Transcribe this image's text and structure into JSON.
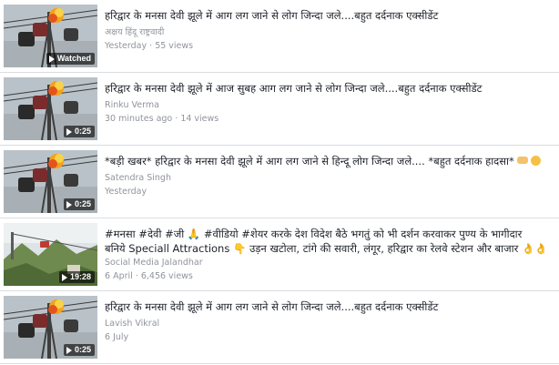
{
  "icons": {
    "play": "play-icon"
  },
  "videos": [
    {
      "title": "हरिद्वार के मनसा देवी झूले में आग लग जाने से लोग जिन्दा जले....बहुत दर्दनाक एक्सीडेंट",
      "channel": "अक्षय हिंदू राष्ट्रवादी",
      "date": "Yesterday",
      "views": "55 views",
      "badge": "Watched"
    },
    {
      "title": "हरिद्वार के मनसा देवी झूले में आज सुबह आग लग जाने से लोग जिन्दा जले....बहुत दर्दनाक एक्सीडेंट",
      "channel": "Rinku Verma",
      "date": "30 minutes ago",
      "views": "14 views",
      "badge": "0:25"
    },
    {
      "title": "*बड़ी खबर* हरिद्वार के मनसा देवी झूले में आग लग जाने से हिन्दू लोग जिन्दा जले.... *बहुत दर्दनाक हादसा*",
      "channel": "Satendra Singh",
      "date": "Yesterday",
      "views": "",
      "badge": "0:25"
    },
    {
      "title_line1": "#मनसा #देवी #जी 🙏 #वीडियो #शेयर करके देश विदेश बैठे भगतुं को भी दर्शन करवाकर पुण्य के भागीदार",
      "title_line2": "बनिये Speciall Attractions 👇 उड़न खटोला, टांगे की सवारी, लंगूर, हरिद्वार का रेलवे स्टेशन और बाजार 👌👌",
      "channel": "Social Media Jalandhar",
      "date": "6 April",
      "views": "6,456 views",
      "badge": "19:28"
    },
    {
      "title": "हरिद्वार के मनसा देवी झूले में आग लग जाने से लोग जिन्दा जले....बहुत दर्दनाक एक्सीडेंट",
      "channel": "Lavish Vikral",
      "date": "6 July",
      "views": "",
      "badge": "0:25"
    }
  ]
}
